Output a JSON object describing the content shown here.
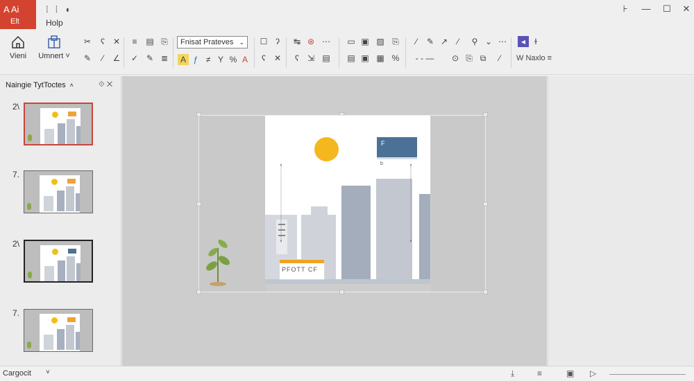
{
  "app": {
    "badge_line1": "A Ai",
    "badge_line2": "Elt",
    "menu_help": "Holp",
    "colors": {
      "brand": "#d4432f",
      "accent": "#5a52b5",
      "sun": "#f4b71d",
      "billboard": "#4b7196"
    }
  },
  "ribbon": {
    "view_label": "Vieni",
    "insert_label": "Umnert ˅",
    "font_value": "Fnisat Prateves",
    "style_label": "W Naxlo ≡"
  },
  "left_pane": {
    "title": "Naingie TytToctes",
    "slides": [
      {
        "number": "2\\"
      },
      {
        "number": "7."
      },
      {
        "number": "2\\"
      },
      {
        "number": "7."
      }
    ]
  },
  "slide": {
    "billboard_text": "F",
    "billboard_note": "b",
    "shop_text": "PFOTT CF"
  },
  "status": {
    "language": "Cargocit",
    "language_dropdown": "˅"
  }
}
